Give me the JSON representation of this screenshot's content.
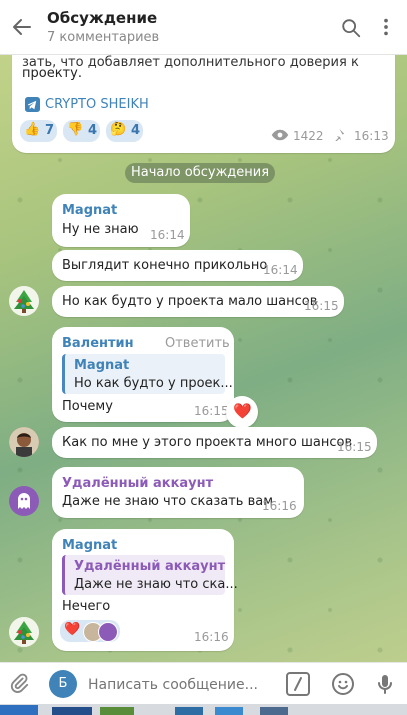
{
  "header": {
    "title": "Обсуждение",
    "subtitle": "7 комментариев"
  },
  "post": {
    "text_line1": "зать, что добавляет дополнительного доверия к",
    "text_line2": "проекту.",
    "channel_link": "CRYPTO SHEIKH",
    "reactions": [
      {
        "emoji": "👍",
        "count": "7"
      },
      {
        "emoji": "👎",
        "count": "4"
      },
      {
        "emoji": "🤔",
        "count": "4"
      }
    ],
    "views": "1422",
    "time": "16:13"
  },
  "date_separator": "Начало обсуждения",
  "messages": [
    {
      "author": "Magnat",
      "text": "Ну не знаю",
      "time": "16:14"
    },
    {
      "text": "Выглядит конечно прикольно",
      "time": "16:14"
    },
    {
      "text": "Но как будто у проекта мало шансов",
      "time": "16:15"
    },
    {
      "author": "Валентин",
      "action": "Ответить",
      "reply_author": "Magnat",
      "reply_text": "Но как будто у проек...",
      "text": "Почему",
      "time": "16:15",
      "reaction": "❤️"
    },
    {
      "text": "Как по мне у этого проекта много шансов",
      "time": "16:15"
    },
    {
      "author": "Удалённый аккаунт",
      "text": "Даже не знаю что сказать вам",
      "time": "16:16"
    },
    {
      "author": "Magnat",
      "reply_author": "Удалённый аккаунт",
      "reply_text": "Даже не знаю что ска...",
      "text": "Нечего",
      "time": "16:16",
      "reaction": "❤️"
    }
  ],
  "composer": {
    "placeholder": "Написать сообщение...",
    "send_as_letter": "Б"
  },
  "colors": {
    "accent": "#3f83b8",
    "magnat": "#3f83b8",
    "valentin": "#3f83b8",
    "deleted": "#8c5bb8"
  }
}
